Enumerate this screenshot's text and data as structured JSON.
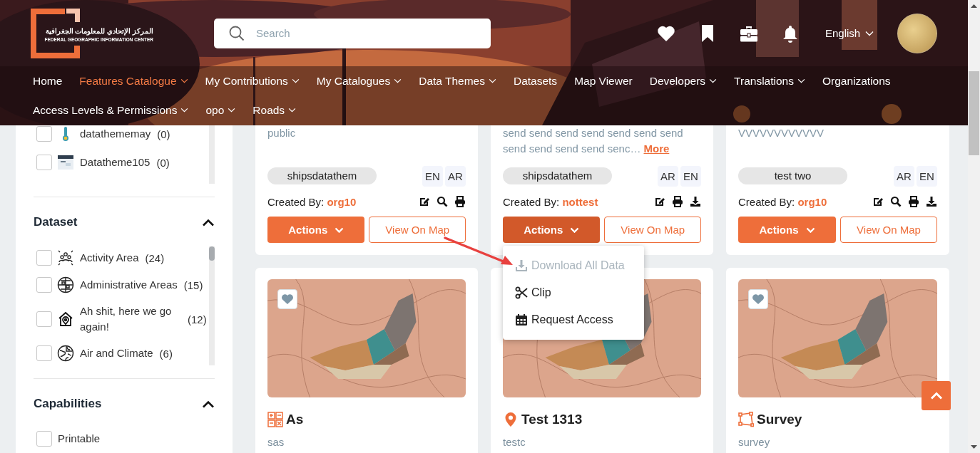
{
  "header": {
    "logo": {
      "arabic": "المركز الإتحادي للمعلومات الجغرافية",
      "english": "FEDERAL GEOGRAPHIC INFORMATION CENTER"
    },
    "search": {
      "placeholder": "Search"
    },
    "language": "English",
    "nav_rows": [
      {
        "items": [
          {
            "label": "Home",
            "selected": false,
            "has_menu": false
          },
          {
            "label": "Features Catalogue",
            "selected": true,
            "has_menu": true
          },
          {
            "label": "My Contributions",
            "selected": false,
            "has_menu": true
          },
          {
            "label": "My Catalogues",
            "selected": false,
            "has_menu": true
          },
          {
            "label": "Data Themes",
            "selected": false,
            "has_menu": true
          },
          {
            "label": "Datasets",
            "selected": false,
            "has_menu": false
          },
          {
            "label": "Map Viewer",
            "selected": false,
            "has_menu": false
          },
          {
            "label": "Developers",
            "selected": false,
            "has_menu": true
          },
          {
            "label": "Translations",
            "selected": false,
            "has_menu": true
          },
          {
            "label": "Organizations",
            "selected": false,
            "has_menu": false
          }
        ]
      },
      {
        "items": [
          {
            "label": "Access Levels & Permissions",
            "selected": false,
            "has_menu": true
          },
          {
            "label": "opo",
            "selected": false,
            "has_menu": true
          },
          {
            "label": "Roads",
            "selected": false,
            "has_menu": true
          }
        ]
      }
    ]
  },
  "sidebar": {
    "top_items": [
      {
        "label": "datathememay",
        "count": "(0)",
        "checked": false,
        "kind": "thermometer"
      },
      {
        "label": "Datatheme105",
        "count": "(0)",
        "checked": false,
        "kind": "thumbnail"
      }
    ],
    "sections": [
      {
        "title": "Dataset",
        "expanded": true,
        "scrollable": true,
        "items": [
          {
            "label": "Activity Area",
            "count": "(24)",
            "checked": false,
            "kind": "people"
          },
          {
            "label": "Administrative Areas",
            "count": "(15)",
            "checked": false,
            "kind": "globe"
          },
          {
            "label": "Ah shit, here we go again!",
            "count": "(12)",
            "checked": false,
            "kind": "house"
          },
          {
            "label": "Air and Climate",
            "count": "(6)",
            "checked": false,
            "kind": "globe-map"
          }
        ]
      },
      {
        "title": "Capabilities",
        "expanded": true,
        "scrollable": false,
        "items": [
          {
            "label": "Printable",
            "checked": false,
            "kind": "none"
          }
        ]
      }
    ]
  },
  "cards_top": [
    {
      "description": "public",
      "tag": "shipsdatathem",
      "languages": [
        "EN",
        "AR"
      ],
      "created_by": "Created By:",
      "creator": "org10",
      "tools": [
        {
          "kind": "edit"
        },
        {
          "kind": "search"
        },
        {
          "kind": "print"
        }
      ],
      "actions": "Actions",
      "actions_open": false,
      "view": "View On Map"
    },
    {
      "description": "send send send send send send send send send send send senc…",
      "more": "More",
      "tag": "shipsdatathem",
      "languages": [
        "AR",
        "EN"
      ],
      "created_by": "Created By:",
      "creator": "nottest",
      "tools": [
        {
          "kind": "edit"
        },
        {
          "kind": "print"
        },
        {
          "kind": "download"
        }
      ],
      "actions": "Actions",
      "actions_open": true,
      "view": "View On Map"
    },
    {
      "description": "VVVVVVVVVVVV",
      "tag": "test two",
      "languages": [
        "AR",
        "EN"
      ],
      "created_by": "Created By:",
      "creator": "org10",
      "tools": [
        {
          "kind": "edit"
        },
        {
          "kind": "search"
        },
        {
          "kind": "print"
        },
        {
          "kind": "download"
        }
      ],
      "actions": "Actions",
      "actions_open": false,
      "view": "View On Map"
    }
  ],
  "actions_menu": [
    {
      "label": "Download All Data",
      "disabled": true,
      "kind": "download"
    },
    {
      "label": "Clip",
      "disabled": false,
      "kind": "scissors"
    },
    {
      "label": "Request Access",
      "disabled": false,
      "kind": "calendar"
    }
  ],
  "cards_bottom": [
    {
      "title": "As",
      "subtitle": "sas",
      "kind": "grid",
      "favorite_button": true
    },
    {
      "title": "Test 1313",
      "subtitle": "testc",
      "kind": "pin"
    },
    {
      "title": "Survey",
      "subtitle": "survey",
      "kind": "polygon",
      "favorite_button": true
    }
  ]
}
